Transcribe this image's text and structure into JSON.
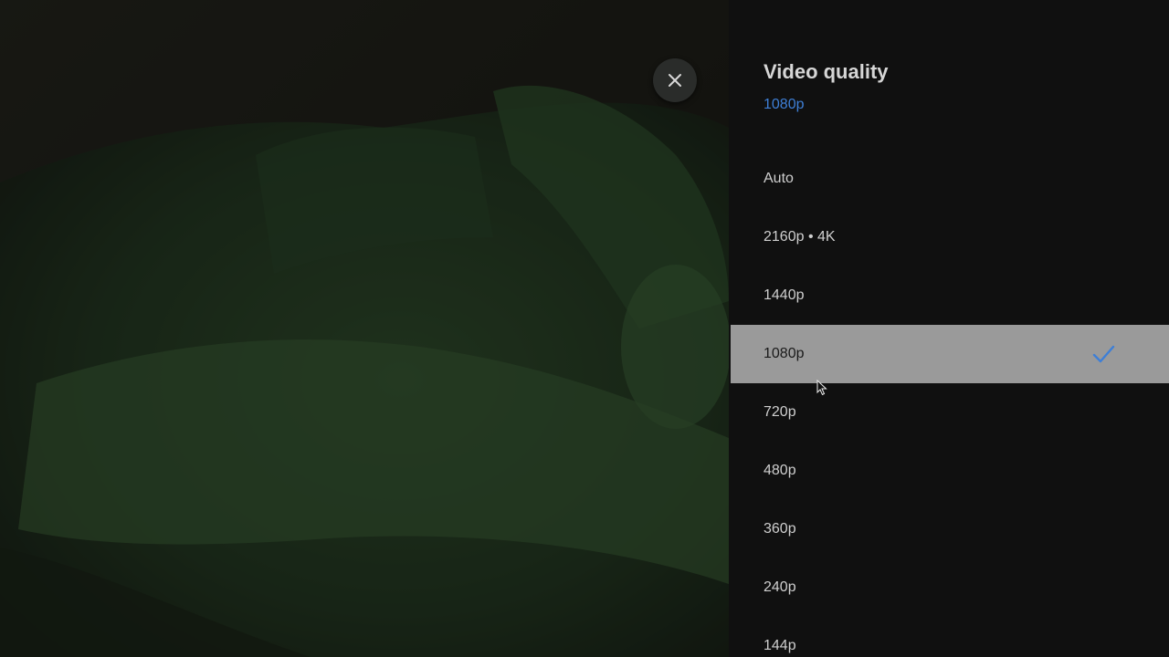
{
  "panel": {
    "title": "Video quality",
    "current_value": "1080p",
    "options": [
      {
        "label": "Auto"
      },
      {
        "label": "2160p • 4K"
      },
      {
        "label": "1440p"
      },
      {
        "label": "1080p",
        "selected": true
      },
      {
        "label": "720p"
      },
      {
        "label": "480p"
      },
      {
        "label": "360p"
      },
      {
        "label": "240p"
      },
      {
        "label": "144p"
      }
    ],
    "selected_index": 3
  },
  "icons": {
    "close": "close-icon",
    "check": "checkmark-icon",
    "cursor": "mouse-pointer-icon"
  },
  "colors": {
    "panel_bg": "#101010",
    "accent": "#3e7fd6",
    "selected_bg": "#9a9a9a"
  }
}
